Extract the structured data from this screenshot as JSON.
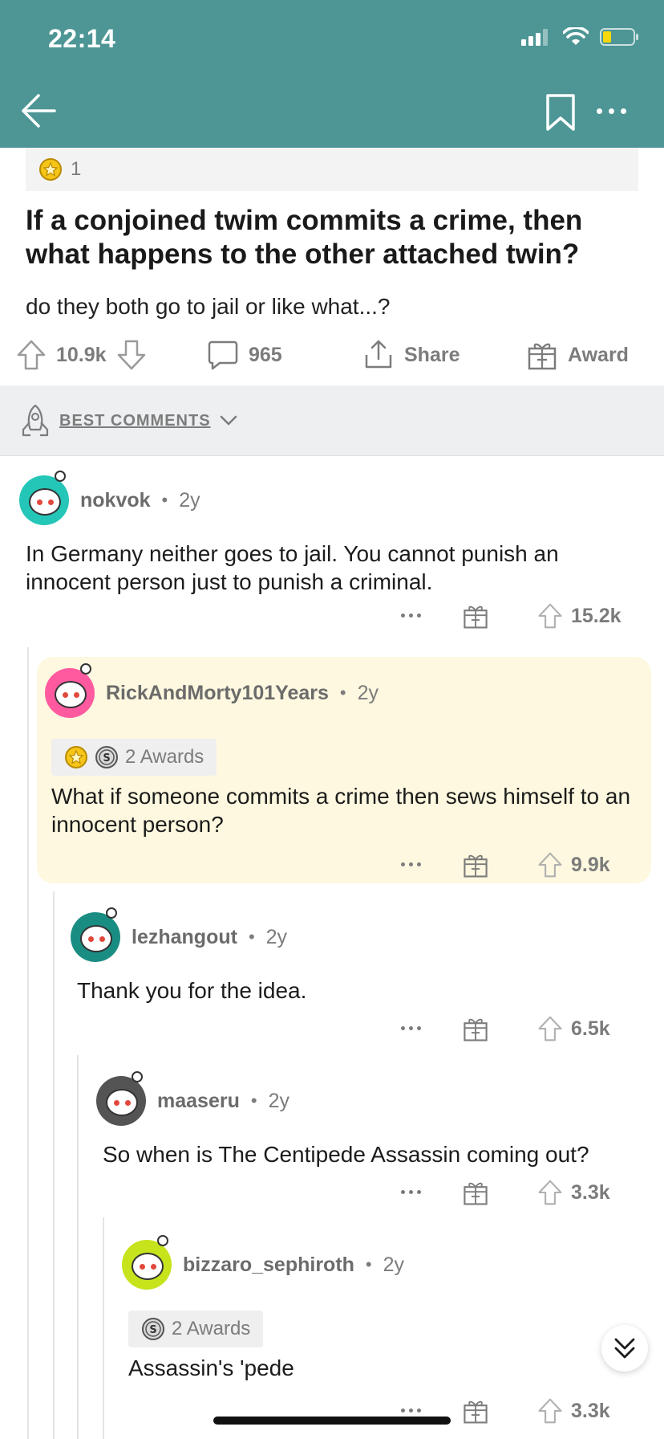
{
  "status_bar": {
    "time": "22:14"
  },
  "post": {
    "award_count": "1",
    "title": "If a conjoined twim commits a crime, then what happens to the other attached twin?",
    "body": "do they both go to jail or like what...?",
    "upvotes": "10.9k",
    "comments": "965",
    "share_label": "Share",
    "award_label": "Award"
  },
  "sort": {
    "label": "BEST COMMENTS"
  },
  "comments": [
    {
      "author": "nokvok",
      "age": "2y",
      "text": "In Germany neither goes to jail. You cannot punish an innocent person just to punish a criminal.",
      "votes": "15.2k",
      "avatar_color": "#24c6b7"
    },
    {
      "author": "RickAndMorty101Years",
      "age": "2y",
      "awards": "2 Awards",
      "text": "What if someone commits a crime then sews himself to an innocent person?",
      "votes": "9.9k",
      "avatar_color": "#ff5aa0"
    },
    {
      "author": "lezhangout",
      "age": "2y",
      "text": "Thank you for the idea.",
      "votes": "6.5k",
      "avatar_color": "#1a8d82"
    },
    {
      "author": "maaseru",
      "age": "2y",
      "text": "So when is The Centipede Assassin coming out?",
      "votes": "3.3k",
      "avatar_color": "#545454"
    },
    {
      "author": "bizzaro_sephiroth",
      "age": "2y",
      "awards": "2 Awards",
      "text": "Assassin's 'pede",
      "votes": "3.3k",
      "avatar_color": "#c6e31c"
    }
  ],
  "colors": {
    "header": "#4d9695",
    "highlight": "#fdf8df"
  }
}
